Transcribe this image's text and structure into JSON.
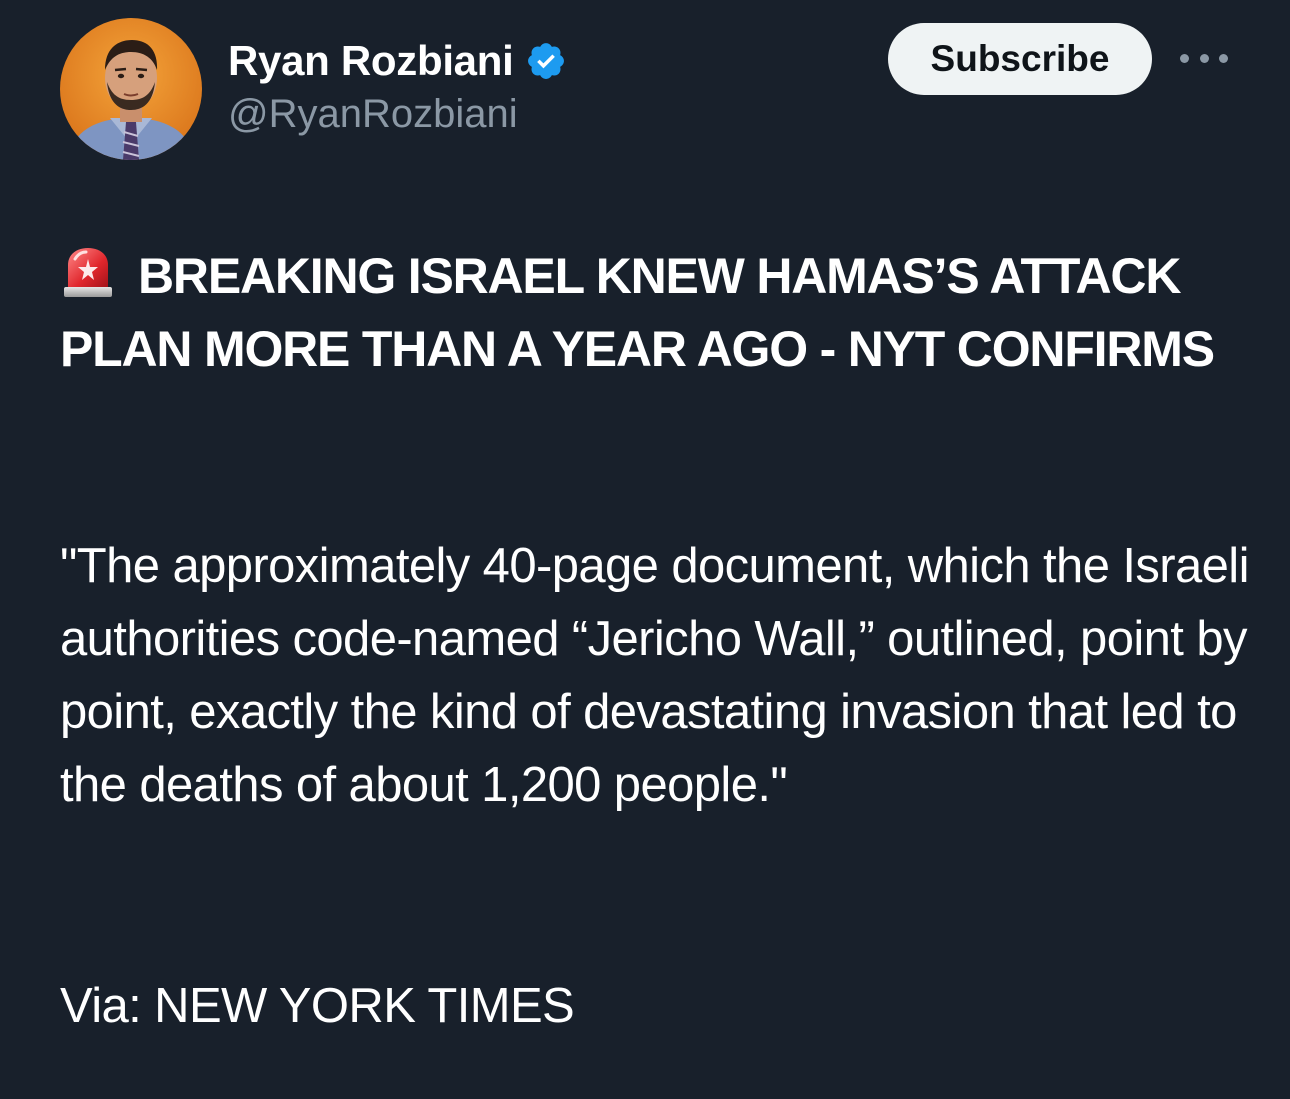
{
  "author": {
    "display_name": "Ryan Rozbiani",
    "handle": "@RyanRozbiani",
    "verified": true,
    "avatar_icon": "profile-photo"
  },
  "actions": {
    "subscribe_label": "Subscribe",
    "more_icon": "more-horizontal-icon"
  },
  "tweet": {
    "headline_icon": "rotating-light-emoji",
    "headline": "BREAKING ISRAEL KNEW HAMAS’S ATTACK PLAN MORE THAN A YEAR AGO - NYT CONFIRMS",
    "quote": "\"The approximately 40-page document, which the Israeli authorities code-named “Jericho Wall,” outlined, point by point, exactly the kind of devastating invasion that led to the deaths of about 1,200 people.\"",
    "via": "Via: NEW YORK TIMES"
  },
  "colors": {
    "background": "#18202b",
    "text_primary": "#ffffff",
    "text_secondary": "#8b98a5",
    "verified_blue": "#1d9bf0",
    "button_bg": "#eff3f4",
    "button_text": "#0f1419",
    "avatar_bg": "#e8871e"
  }
}
